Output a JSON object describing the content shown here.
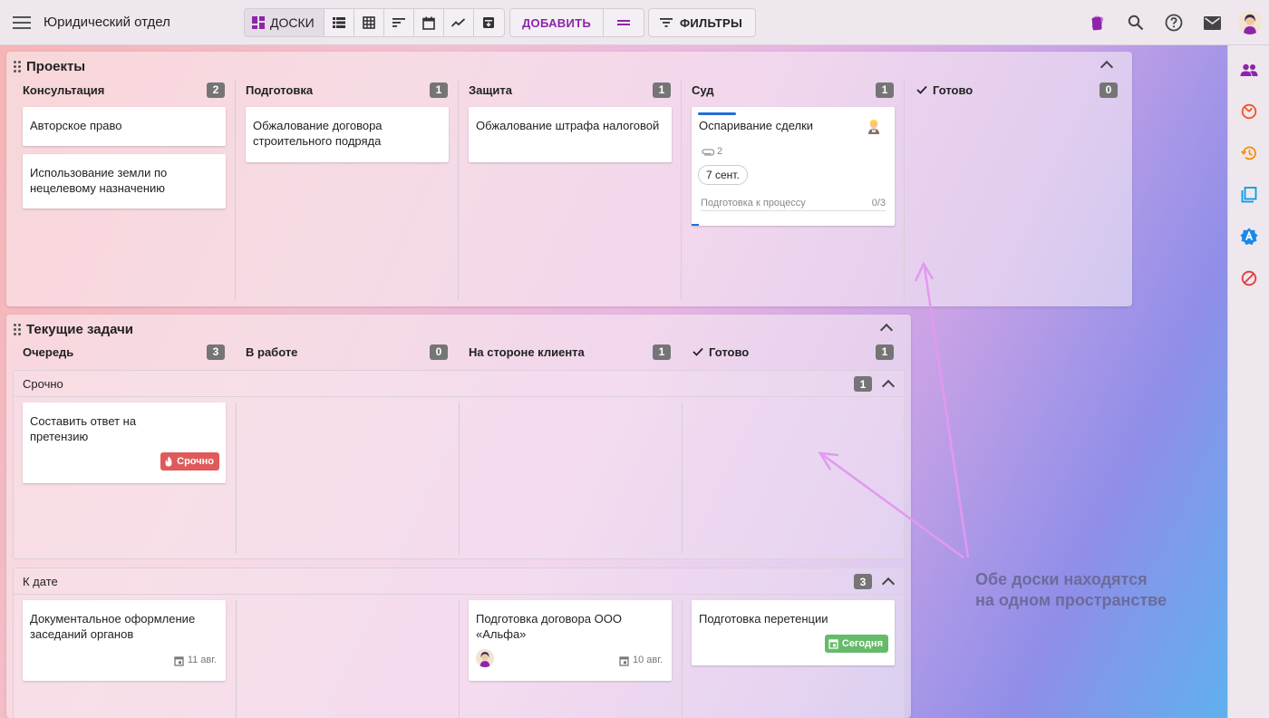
{
  "app": {
    "title": "Юридический отдел"
  },
  "toolbar": {
    "boards_label": "ДОСКИ",
    "add_label": "ДОБАВИТЬ",
    "filters_label": "ФИЛЬТРЫ"
  },
  "colors": {
    "accent": "#8e24aa",
    "urgent": "#e05a5a",
    "today": "#66bb6a",
    "badge": "#757575"
  },
  "board1": {
    "title": "Проекты",
    "columns": [
      {
        "name": "Консультация",
        "count": "2"
      },
      {
        "name": "Подготовка",
        "count": "1"
      },
      {
        "name": "Защита",
        "count": "1"
      },
      {
        "name": "Суд",
        "count": "1"
      },
      {
        "name": "Готово",
        "count": "0"
      }
    ],
    "cards": {
      "c1": "Авторское право",
      "c2": "Использование земли по нецелевому назначению",
      "c3": "Обжалование договора строительного подряда",
      "c4": "Обжалование штрафа налоговой",
      "c5": {
        "title": "Оспаривание сделки",
        "attachments": "2",
        "date": "7 сент.",
        "checklist": "Подготовка к процессу",
        "progress": "0/3"
      }
    }
  },
  "board2": {
    "title": "Текущие задачи",
    "columns": [
      {
        "name": "Очередь",
        "count": "3"
      },
      {
        "name": "В работе",
        "count": "0"
      },
      {
        "name": "На стороне клиента",
        "count": "1"
      },
      {
        "name": "Готово",
        "count": "1"
      }
    ],
    "lanes": [
      {
        "name": "Срочно",
        "count": "1"
      },
      {
        "name": "К дате",
        "count": "3"
      }
    ],
    "cards": {
      "u1": {
        "title": "Составить ответ на претензию",
        "tag": "Срочно"
      },
      "d1": {
        "title": "Документальное оформление заседаний органов",
        "date": "11 авг."
      },
      "d2": {
        "title": "Подготовка договора ООО «Альфа»",
        "date": "10 авг."
      },
      "d3": {
        "title": "Подготовка перетенции",
        "tag": "Сегодня"
      }
    }
  },
  "annotation": {
    "line1": "Обе доски находятся",
    "line2": "на одном пространстве"
  }
}
